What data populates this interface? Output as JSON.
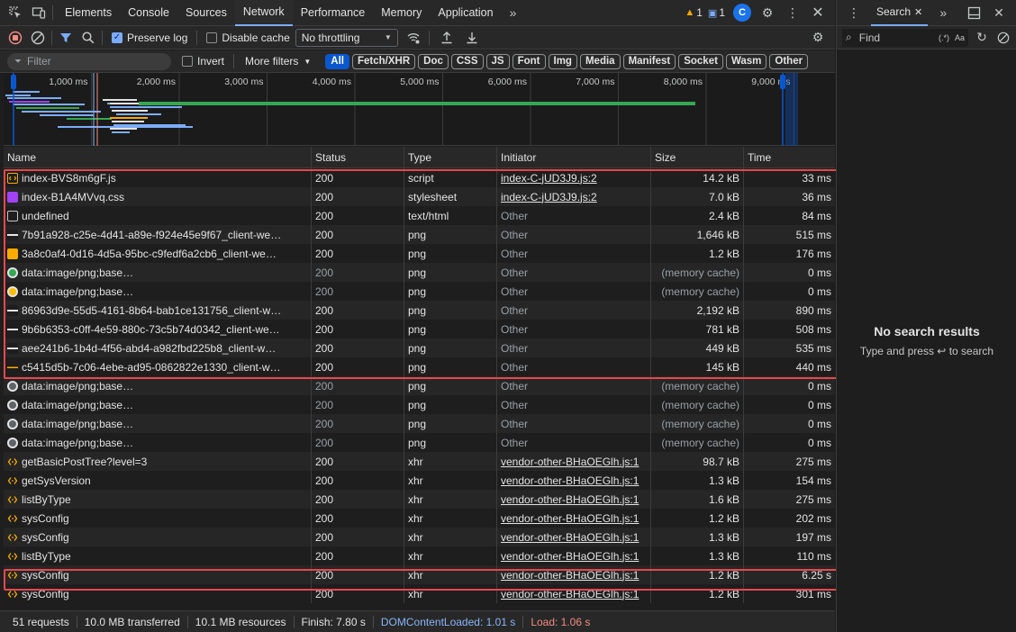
{
  "tabs": [
    "Elements",
    "Console",
    "Sources",
    "Network",
    "Performance",
    "Memory",
    "Application"
  ],
  "active_tab": "Network",
  "badges": {
    "warnings": "1",
    "messages": "1"
  },
  "toolbar": {
    "preserve_log": "Preserve log",
    "disable_cache": "Disable cache",
    "throttling": "No throttling"
  },
  "filter": {
    "placeholder": "Filter",
    "invert": "Invert",
    "more_filters": "More filters",
    "types": [
      "All",
      "Fetch/XHR",
      "Doc",
      "CSS",
      "JS",
      "Font",
      "Img",
      "Media",
      "Manifest",
      "Socket",
      "Wasm",
      "Other"
    ]
  },
  "overview_ticks": [
    "1,000 ms",
    "2,000 ms",
    "3,000 ms",
    "4,000 ms",
    "5,000 ms",
    "6,000 ms",
    "7,000 ms",
    "8,000 ms",
    "9,000 ms"
  ],
  "columns": [
    "Name",
    "Status",
    "Type",
    "Initiator",
    "Size",
    "Time"
  ],
  "rows": [
    {
      "name": "index-BVS8m6gF.js",
      "status": "200",
      "type": "script",
      "initiator": "index-C-jUD3J9.js:2",
      "size": "14.2 kB",
      "time": "33 ms",
      "icon": "script",
      "linked": true,
      "dim": false
    },
    {
      "name": "index-B1A4MVvq.css",
      "status": "200",
      "type": "stylesheet",
      "initiator": "index-C-jUD3J9.js:2",
      "size": "7.0 kB",
      "time": "36 ms",
      "icon": "css",
      "linked": true,
      "dim": false
    },
    {
      "name": "undefined",
      "status": "200",
      "type": "text/html",
      "initiator": "Other",
      "size": "2.4 kB",
      "time": "84 ms",
      "icon": "doc",
      "linked": false,
      "dim": false
    },
    {
      "name": "7b91a928-c25e-4d41-a89e-f924e45e9f67_client-we…",
      "status": "200",
      "type": "png",
      "initiator": "Other",
      "size": "1,646 kB",
      "time": "515 ms",
      "icon": "img-white",
      "linked": false,
      "dim": false
    },
    {
      "name": "3a8c0af4-0d16-4d5a-95bc-c9fedf6a2cb6_client-we…",
      "status": "200",
      "type": "png",
      "initiator": "Other",
      "size": "1.2 kB",
      "time": "176 ms",
      "icon": "img-orange",
      "linked": false,
      "dim": false
    },
    {
      "name": "data:image/png;base…",
      "status": "200",
      "type": "png",
      "initiator": "Other",
      "size": "(memory cache)",
      "time": "0 ms",
      "icon": "dot-green",
      "linked": false,
      "dim": true
    },
    {
      "name": "data:image/png;base…",
      "status": "200",
      "type": "png",
      "initiator": "Other",
      "size": "(memory cache)",
      "time": "0 ms",
      "icon": "dot-yellow",
      "linked": false,
      "dim": true
    },
    {
      "name": "86963d9e-55d5-4161-8b64-bab1ce131756_client-w…",
      "status": "200",
      "type": "png",
      "initiator": "Other",
      "size": "2,192 kB",
      "time": "890 ms",
      "icon": "img-white",
      "linked": false,
      "dim": false
    },
    {
      "name": "9b6b6353-c0ff-4e59-880c-73c5b74d0342_client-we…",
      "status": "200",
      "type": "png",
      "initiator": "Other",
      "size": "781 kB",
      "time": "508 ms",
      "icon": "img-white",
      "linked": false,
      "dim": false
    },
    {
      "name": "aee241b6-1b4d-4f56-abd4-a982fbd225b8_client-w…",
      "status": "200",
      "type": "png",
      "initiator": "Other",
      "size": "449 kB",
      "time": "535 ms",
      "icon": "img-white",
      "linked": false,
      "dim": false
    },
    {
      "name": "c5415d5b-7c06-4ebe-ad95-0862822e1330_client-w…",
      "status": "200",
      "type": "png",
      "initiator": "Other",
      "size": "145 kB",
      "time": "440 ms",
      "icon": "img-line",
      "linked": false,
      "dim": false
    },
    {
      "name": "data:image/png;base…",
      "status": "200",
      "type": "png",
      "initiator": "Other",
      "size": "(memory cache)",
      "time": "0 ms",
      "icon": "dot-grey",
      "linked": false,
      "dim": true
    },
    {
      "name": "data:image/png;base…",
      "status": "200",
      "type": "png",
      "initiator": "Other",
      "size": "(memory cache)",
      "time": "0 ms",
      "icon": "dot-grey",
      "linked": false,
      "dim": true
    },
    {
      "name": "data:image/png;base…",
      "status": "200",
      "type": "png",
      "initiator": "Other",
      "size": "(memory cache)",
      "time": "0 ms",
      "icon": "dot-grey",
      "linked": false,
      "dim": true
    },
    {
      "name": "data:image/png;base…",
      "status": "200",
      "type": "png",
      "initiator": "Other",
      "size": "(memory cache)",
      "time": "0 ms",
      "icon": "dot-grey",
      "linked": false,
      "dim": true
    },
    {
      "name": "getBasicPostTree?level=3",
      "status": "200",
      "type": "xhr",
      "initiator": "vendor-other-BHaOEGlh.js:1",
      "size": "98.7 kB",
      "time": "275 ms",
      "icon": "xhr",
      "linked": true,
      "dim": false
    },
    {
      "name": "getSysVersion",
      "status": "200",
      "type": "xhr",
      "initiator": "vendor-other-BHaOEGlh.js:1",
      "size": "1.3 kB",
      "time": "154 ms",
      "icon": "xhr",
      "linked": true,
      "dim": false
    },
    {
      "name": "listByType",
      "status": "200",
      "type": "xhr",
      "initiator": "vendor-other-BHaOEGlh.js:1",
      "size": "1.6 kB",
      "time": "275 ms",
      "icon": "xhr",
      "linked": true,
      "dim": false
    },
    {
      "name": "sysConfig",
      "status": "200",
      "type": "xhr",
      "initiator": "vendor-other-BHaOEGlh.js:1",
      "size": "1.2 kB",
      "time": "202 ms",
      "icon": "xhr",
      "linked": true,
      "dim": false
    },
    {
      "name": "sysConfig",
      "status": "200",
      "type": "xhr",
      "initiator": "vendor-other-BHaOEGlh.js:1",
      "size": "1.3 kB",
      "time": "197 ms",
      "icon": "xhr",
      "linked": true,
      "dim": false
    },
    {
      "name": "listByType",
      "status": "200",
      "type": "xhr",
      "initiator": "vendor-other-BHaOEGlh.js:1",
      "size": "1.3 kB",
      "time": "110 ms",
      "icon": "xhr",
      "linked": true,
      "dim": false
    },
    {
      "name": "sysConfig",
      "status": "200",
      "type": "xhr",
      "initiator": "vendor-other-BHaOEGlh.js:1",
      "size": "1.2 kB",
      "time": "6.25 s",
      "icon": "xhr",
      "linked": true,
      "dim": false
    },
    {
      "name": "sysConfig",
      "status": "200",
      "type": "xhr",
      "initiator": "vendor-other-BHaOEGlh.js:1",
      "size": "1.2 kB",
      "time": "301 ms",
      "icon": "xhr",
      "linked": true,
      "dim": false
    }
  ],
  "statusbar": {
    "requests": "51 requests",
    "transferred": "10.0 MB transferred",
    "resources": "10.1 MB resources",
    "finish": "Finish: 7.80 s",
    "dcl": "DOMContentLoaded: 1.01 s",
    "load": "Load: 1.06 s"
  },
  "search": {
    "tab": "Search",
    "placeholder": "Find",
    "regex": "(.*)",
    "case": "Aa",
    "empty_title": "No search results",
    "empty_hint": "Type and press ↩ to search"
  },
  "colors": {
    "accent": "#7cacf8",
    "highlight": "#e5484d",
    "dcl": "#8ab4f8",
    "load": "#f28b82"
  }
}
